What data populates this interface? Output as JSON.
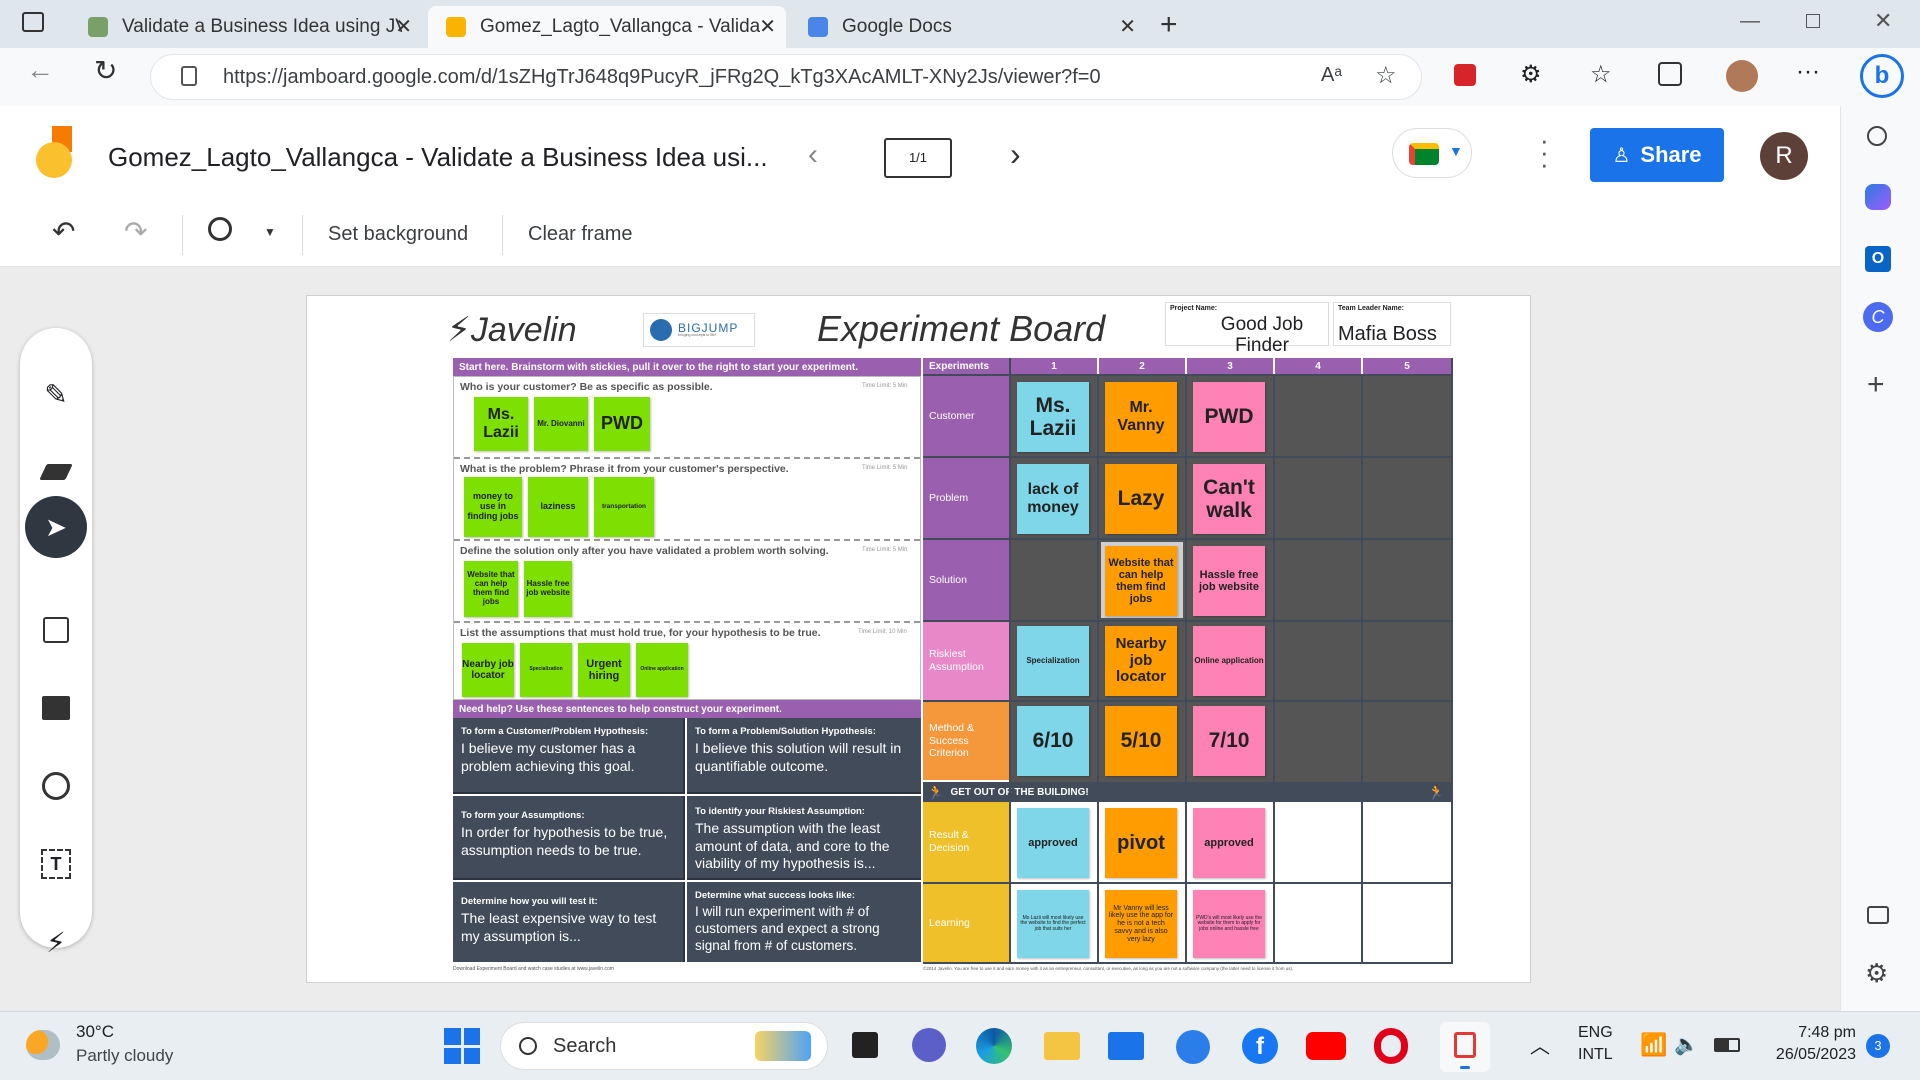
{
  "browser": {
    "tabs": [
      {
        "title": "Validate a Business Idea using JV",
        "active": false
      },
      {
        "title": "Gomez_Lagto_Vallangca - Validat",
        "active": true
      },
      {
        "title": "Google Docs",
        "active": false
      }
    ],
    "url": "https://jamboard.google.com/d/1sZHgTrJ648q9PucyR_jFRg2Q_kTg3XAcAMLT-XNy2Js/viewer?f=0",
    "profile_initial": "R"
  },
  "jamboard": {
    "title": "Gomez_Lagto_Vallangca - Validate a Business Idea usi...",
    "frame_counter": "1/1",
    "share_label": "Share",
    "avatar_initial": "R",
    "toolbar": {
      "set_background": "Set background",
      "clear_frame": "Clear frame"
    }
  },
  "board": {
    "brand": "Javelin",
    "partner": "BIGJUMP",
    "partner_tagline": "bringing concepts to life!",
    "title": "Experiment Board",
    "project_name_label": "Project Name:",
    "project_name": "Good Job Finder",
    "team_leader_label": "Team Leader Name:",
    "team_leader": "Mafia Boss",
    "start_here": "Start here. Brainstorm with stickies, pull it over to the right to start your experiment.",
    "questions": [
      {
        "text": "Who is your customer? Be as specific as possible.",
        "time": "Time Limit: 5 Min"
      },
      {
        "text": "What is the problem? Phrase it from your customer's perspective.",
        "time": "Time Limit: 5 Min"
      },
      {
        "text": "Define the solution only after you have validated a problem worth solving.",
        "time": "Time Limit: 5 Min"
      },
      {
        "text": "List the assumptions that must hold true, for your hypothesis to be true.",
        "time": "Time Limit: 10 Min"
      }
    ],
    "brainstorm": {
      "customers": [
        "Ms. Lazii",
        "Mr. Diovanni",
        "PWD"
      ],
      "problems": [
        "money to use in finding jobs",
        "laziness",
        "transportation"
      ],
      "solutions": [
        "Website that can help them find jobs",
        "Hassle free job website"
      ],
      "assumptions": [
        "Nearby job locator",
        "Specialization",
        "Urgent hiring",
        "Online application"
      ]
    },
    "need_help": "Need help? Use these sentences to help construct your experiment.",
    "hypotheses": [
      {
        "sub": "To form a Customer/Problem Hypothesis:",
        "main": "I believe my customer has a problem achieving this goal."
      },
      {
        "sub": "To form a Problem/Solution Hypothesis:",
        "main": "I believe this solution will result in quantifiable outcome."
      },
      {
        "sub": "To form your Assumptions:",
        "main": "In order for hypothesis to be true, assumption needs to be true."
      },
      {
        "sub": "To identify your Riskiest Assumption:",
        "main": "The assumption with the least amount of data, and core to the viability of my hypothesis is..."
      },
      {
        "sub": "Determine how you will test it:",
        "main": "The least expensive way to test my assumption is..."
      },
      {
        "sub": "Determine what success looks like:",
        "main": "I will run experiment with # of customers and expect a strong signal from # of customers."
      }
    ],
    "experiments_header": "Experiments",
    "experiment_numbers": [
      "1",
      "2",
      "3",
      "4",
      "5"
    ],
    "row_labels": [
      "Customer",
      "Problem",
      "Solution",
      "Riskiest Assumption",
      "Method & Success Criterion",
      "Result & Decision",
      "Learning"
    ],
    "get_out": "GET OUT OF THE BUILDING!",
    "grid": {
      "customer": [
        "Ms. Lazii",
        "Mr. Vanny",
        "PWD"
      ],
      "problem": [
        "lack of money",
        "Lazy",
        "Can't walk"
      ],
      "solution": [
        "",
        "Website that can help them find jobs",
        "Hassle free job website"
      ],
      "riskiest": [
        "Specialization",
        "Nearby job locator",
        "Online application"
      ],
      "method": [
        "6/10",
        "5/10",
        "7/10"
      ],
      "result": [
        "approved",
        "pivot",
        "approved"
      ],
      "learning": [
        "Ms Lazii will most likely use the website to find the perfect job that suits her",
        "Mr Vanny will less likely use the app for he is not a tech savvy and is also very lazy",
        "PWD's will most likely use the website for them to apply for jobs online and hassle free"
      ]
    },
    "footer_left": "Download Experiment Board and watch case studies at www.javelin.com",
    "footer_right": "©2014 Javelin. You are free to use it and earn money with it as an entrepreneur, consultant, or executive, as long as you are not a software company (the latter need to license it from us)."
  },
  "taskbar": {
    "weather_temp": "30°C",
    "weather_desc": "Partly cloudy",
    "search_placeholder": "Search",
    "lang1": "ENG",
    "lang2": "INTL",
    "time": "7:48 pm",
    "date": "26/05/2023",
    "notifications": "3"
  }
}
